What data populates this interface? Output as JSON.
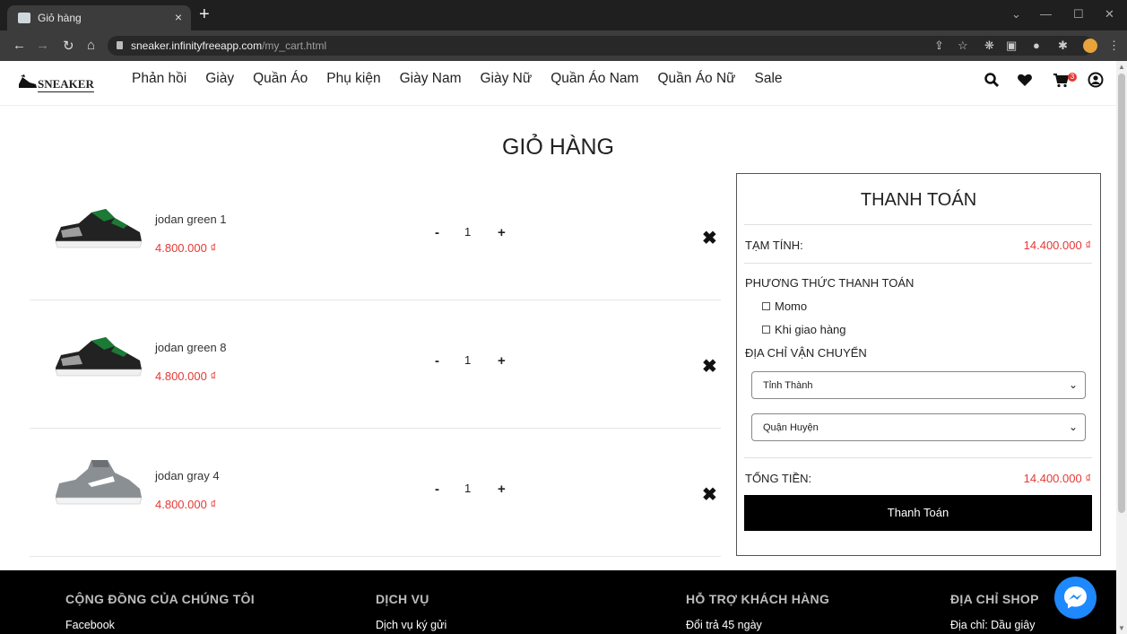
{
  "browser": {
    "tab_title": "Giỏ hàng",
    "tab_close": "×",
    "new_tab": "+",
    "url_host": "sneaker.infinityfreeapp.com",
    "url_path": "/my_cart.html"
  },
  "header": {
    "logo": "SNEAKER",
    "menu": [
      "Phản hồi",
      "Giày",
      "Quần Áo",
      "Phụ kiện",
      "Giày Nam",
      "Giày Nữ",
      "Quần Áo Nam",
      "Quần Áo Nữ",
      "Sale"
    ],
    "cart_count": "3"
  },
  "page": {
    "title": "GIỎ HÀNG"
  },
  "cart": {
    "items": [
      {
        "name": "jodan green 1",
        "price": "4.800.000 ₫",
        "qty": "1",
        "minus": "-",
        "plus": "+",
        "color": "green"
      },
      {
        "name": "jodan green 8",
        "price": "4.800.000 ₫",
        "qty": "1",
        "minus": "-",
        "plus": "+",
        "color": "green"
      },
      {
        "name": "jodan gray 4",
        "price": "4.800.000 ₫",
        "qty": "1",
        "minus": "-",
        "plus": "+",
        "color": "gray"
      }
    ],
    "remove_glyph": "✖"
  },
  "checkout": {
    "title": "THANH TOÁN",
    "subtotal_label": "TẠM TÍNH:",
    "subtotal_value": "14.400.000 ₫",
    "payment_label": "PHƯƠNG THỨC THANH TOÁN",
    "payment_options": [
      "Momo",
      "Khi giao hàng"
    ],
    "shipping_label": "ĐỊA CHỈ VẬN CHUYỂN",
    "province_placeholder": "Tỉnh Thành",
    "district_placeholder": "Quận Huyện",
    "total_label": "TỔNG TIỀN:",
    "total_value": "14.400.000 ₫",
    "pay_button": "Thanh Toán"
  },
  "footer": {
    "columns": [
      {
        "heading": "CỘNG ĐỒNG CỦA CHÚNG TÔI",
        "link": "Facebook"
      },
      {
        "heading": "DỊCH VỤ",
        "link": "Dịch vụ ký gửi"
      },
      {
        "heading": "HỖ TRỢ KHÁCH HÀNG",
        "link": "Đổi trả 45 ngày"
      },
      {
        "heading": "ĐỊA CHỈ SHOP",
        "link": "Địa chỉ: Dầu giây"
      }
    ]
  },
  "colors": {
    "accent_price": "#e53935",
    "footer_bg": "#000000",
    "pay_button_bg": "#000000",
    "messenger": "#1e88ff"
  }
}
